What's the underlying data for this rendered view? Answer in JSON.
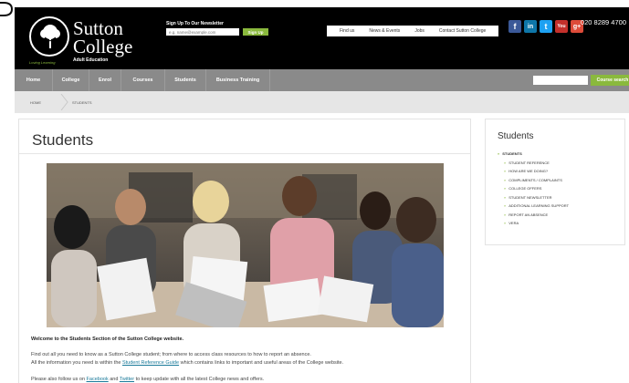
{
  "header": {
    "logo_line1": "Sutton",
    "logo_line2": "College",
    "logo_sub": "Adult Education",
    "logo_ring": "Loving Learning",
    "newsletter_title": "Sign Up To Our Newsletter",
    "newsletter_placeholder": "e.g. name@example.com",
    "signup_label": "Sign Up",
    "toplinks": [
      "Find us",
      "News & Events",
      "Jobs",
      "Contact Sutton College"
    ],
    "phone": "020 8289 4700",
    "social": [
      {
        "name": "facebook-icon",
        "glyph": "f",
        "color": "#3b5998"
      },
      {
        "name": "linkedin-icon",
        "glyph": "in",
        "color": "#0e76a8"
      },
      {
        "name": "twitter-icon",
        "glyph": "t",
        "color": "#1da1f2"
      },
      {
        "name": "youtube-icon",
        "glyph": "You",
        "color": "#c4302b"
      },
      {
        "name": "googleplus-icon",
        "glyph": "g+",
        "color": "#dd4b39"
      }
    ]
  },
  "nav": {
    "items": [
      "Home",
      "College",
      "Enrol",
      "Courses",
      "Students",
      "Business Training"
    ],
    "search_label": "Course search"
  },
  "breadcrumb": {
    "home": "HOME",
    "current": "STUDENTS"
  },
  "main": {
    "title": "Students",
    "welcome": "Welcome to the Students Section of the Sutton College website.",
    "intro1": "Find out all you need to know as a Sutton College student; from where to access class resources to how to report an absence.",
    "intro2_pre": "All the information you need is within the ",
    "intro2_link": "Student Reference Guide",
    "intro2_post": " which contains links to important and useful areas of the College website.",
    "intro3_pre": "Please also follow us on ",
    "intro3_link1": "Facebook",
    "intro3_mid": " and ",
    "intro3_link2": "Twitter",
    "intro3_post": " to keep update with all the latest College news and offers."
  },
  "sidebar": {
    "title": "Students",
    "main_item": "STUDENTS",
    "items": [
      "STUDENT REFERENCE",
      "HOW ARE WE DOING?",
      "COMPLIMENTS / COMPLAINTS",
      "COLLEGE OFFERS",
      "STUDENT NEWSLETTER",
      "ADDITIONAL LEARNING SUPPORT",
      "REPORT AN ABSENCE",
      "VERA"
    ]
  },
  "colors": {
    "accent": "#8ab93d",
    "nav": "#8a8a8a",
    "header": "#000000",
    "link": "#1a7a9a"
  }
}
